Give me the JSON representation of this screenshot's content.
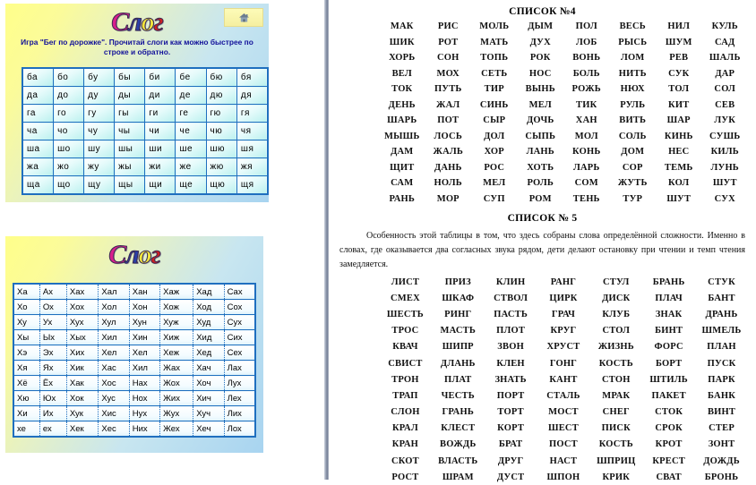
{
  "panel_syllables": {
    "logo": {
      "c": "С",
      "l": "л",
      "o": "о",
      "g": "г"
    },
    "home_icon": "home-icon",
    "subtitle": "Игра \"Бег по дорожке\". Прочитай слоги как можно быстрее по строке и обратно.",
    "grid": [
      [
        "ба",
        "бо",
        "бу",
        "бы",
        "би",
        "бе",
        "бю",
        "бя"
      ],
      [
        "да",
        "до",
        "ду",
        "ды",
        "ди",
        "де",
        "дю",
        "дя"
      ],
      [
        "га",
        "го",
        "гу",
        "гы",
        "ги",
        "ге",
        "гю",
        "гя"
      ],
      [
        "ча",
        "чо",
        "чу",
        "чы",
        "чи",
        "че",
        "чю",
        "чя"
      ],
      [
        "ша",
        "шо",
        "шу",
        "шы",
        "ши",
        "ше",
        "шю",
        "шя"
      ],
      [
        "жа",
        "жо",
        "жу",
        "жы",
        "жи",
        "же",
        "жю",
        "жя"
      ],
      [
        "ща",
        "що",
        "щу",
        "щы",
        "щи",
        "ще",
        "щю",
        "щя"
      ]
    ]
  },
  "panel_table_x": {
    "logo": {
      "c": "С",
      "l": "л",
      "o": "о",
      "g": "г"
    },
    "grid": [
      [
        "Ха",
        "Ах",
        "Хах",
        "Хал",
        "Хан",
        "Хаж",
        "Хад",
        "Сах"
      ],
      [
        "Хо",
        "Ох",
        "Хох",
        "Хол",
        "Хон",
        "Хож",
        "Ход",
        "Сох"
      ],
      [
        "Ху",
        "Ух",
        "Хух",
        "Хул",
        "Хун",
        "Хуж",
        "Худ",
        "Сух"
      ],
      [
        "Хы",
        "Ых",
        "Хых",
        "Хил",
        "Хин",
        "Хиж",
        "Хид",
        "Сих"
      ],
      [
        "Хэ",
        "Эх",
        "Хих",
        "Хел",
        "Хел",
        "Хеж",
        "Хед",
        "Сех"
      ],
      [
        "Хя",
        "Ях",
        "Хик",
        "Хас",
        "Хил",
        "Жах",
        "Хач",
        "Лах"
      ],
      [
        "Хё",
        "Ёх",
        "Хак",
        "Хос",
        "Нах",
        "Жох",
        "Хоч",
        "Лух"
      ],
      [
        "Хю",
        "Юх",
        "Хок",
        "Хус",
        "Нох",
        "Жих",
        "Хич",
        "Лех"
      ],
      [
        "Хи",
        "Их",
        "Хук",
        "Хис",
        "Нух",
        "Жух",
        "Хуч",
        "Лих"
      ],
      [
        "хе",
        "ех",
        "Хек",
        "Хес",
        "Них",
        "Жех",
        "Хеч",
        "Лох"
      ]
    ]
  },
  "list4": {
    "title": "СПИСОК №4",
    "rows": [
      [
        "МАК",
        "РИС",
        "МОЛЬ",
        "ДЫМ",
        "ПОЛ",
        "ВЕСЬ",
        "НИЛ",
        "КУЛЬ"
      ],
      [
        "ШИК",
        "РОТ",
        "МАТЬ",
        "ДУХ",
        "ЛОБ",
        "РЫСЬ",
        "ШУМ",
        "САД"
      ],
      [
        "ХОРЬ",
        "СОН",
        "ТОПЬ",
        "РОК",
        "ВОНЬ",
        "ЛОМ",
        "РЕВ",
        "ШАЛЬ"
      ],
      [
        "ВЕЛ",
        "МОХ",
        "СЕТЬ",
        "НОС",
        "БОЛЬ",
        "НИТЬ",
        "СУК",
        "ДАР"
      ],
      [
        "ТОК",
        "ПУТЬ",
        "ТИР",
        "ВЫНЬ",
        "РОЖЬ",
        "НЮХ",
        "ТОЛ",
        "СОЛ"
      ],
      [
        "ДЕНЬ",
        "ЖАЛ",
        "СИНЬ",
        "МЕЛ",
        "ТИК",
        "РУЛЬ",
        "КИТ",
        "СЕВ"
      ],
      [
        "ШАРЬ",
        "ПОТ",
        "СЫР",
        "ДОЧЬ",
        "ХАН",
        "ВИТЬ",
        "ШАР",
        "ЛУК"
      ],
      [
        "МЫШЬ",
        "ЛОСЬ",
        "ДОЛ",
        "СЫПЬ",
        "МОЛ",
        "СОЛЬ",
        "КИНЬ",
        "СУШЬ"
      ],
      [
        "ДАМ",
        "ЖАЛЬ",
        "ХОР",
        "ЛАНЬ",
        "КОНЬ",
        "ДОМ",
        "НЕС",
        "КИЛЬ"
      ],
      [
        "ЩИТ",
        "ДАНЬ",
        "РОС",
        "ХОТЬ",
        "ЛАРЬ",
        "СОР",
        "ТЕМЬ",
        "ЛУНЬ"
      ],
      [
        "САМ",
        "НОЛЬ",
        "МЕЛ",
        "РОЛЬ",
        "СОМ",
        "ЖУТЬ",
        "КОЛ",
        "ШУТ"
      ],
      [
        "РАНЬ",
        "МОР",
        "СУП",
        "РОМ",
        "ТЕНЬ",
        "ТУР",
        "ШУТ",
        "СУХ"
      ]
    ]
  },
  "list5": {
    "title": "СПИСОК № 5",
    "intro": "Особенность этой таблицы в том, что здесь собраны слова определённой сложности. Именно в словах, где оказывается два  согласных звука рядом, дети делают остановку при чтении и темп чтения замедляется.",
    "rows": [
      [
        "ЛИСТ",
        "ПРИЗ",
        "КЛИН",
        "РАНГ",
        "СТУЛ",
        "БРАНЬ",
        "СТУК"
      ],
      [
        "СМЕХ",
        "ШКАФ",
        "СТВОЛ",
        "ЦИРК",
        "ДИСК",
        "ПЛАЧ",
        "БАНТ"
      ],
      [
        "ШЕСТЬ",
        "РИНГ",
        "ПАСТЬ",
        "ГРАЧ",
        "КЛУБ",
        "ЗНАК",
        "ДРАНЬ"
      ],
      [
        "ТРОС",
        "МАСТЬ",
        "ПЛОТ",
        "КРУГ",
        "СТОЛ",
        "БИНТ",
        "ШМЕЛЬ"
      ],
      [
        "КВАЧ",
        "ШИПР",
        "ЗВОН",
        "ХРУСТ",
        "ЖИЗНЬ",
        "ФОРС",
        "ПЛАН"
      ],
      [
        "СВИСТ",
        "ДЛАНЬ",
        "КЛЕН",
        "ГОНГ",
        "КОСТЬ",
        "БОРТ",
        "ПУСК"
      ],
      [
        "ТРОН",
        "ПЛАТ",
        "ЗНАТЬ",
        "КАНТ",
        "СТОН",
        "ШТИЛЬ",
        "ПАРК"
      ],
      [
        "ТРАП",
        "ЧЕСТЬ",
        "ПОРТ",
        "СТАЛЬ",
        "МРАК",
        "ПАКЕТ",
        "БАНК"
      ],
      [
        "СЛОН",
        "ГРАНЬ",
        "ТОРТ",
        "МОСТ",
        "СНЕГ",
        "СТОК",
        "ВИНТ"
      ],
      [
        "КРАЛ",
        "КЛЕСТ",
        "КОРТ",
        "ШЕСТ",
        "ПИСК",
        "СРОК",
        "СТЕР"
      ],
      [
        "КРАН",
        "ВОЖДЬ",
        "БРАТ",
        "ПОСТ",
        "КОСТЬ",
        "КРОТ",
        "ЗОНТ"
      ],
      [
        "СКОТ",
        "ВЛАСТЬ",
        "ДРУГ",
        "НАСТ",
        "ШПРИЦ",
        "КРЕСТ",
        "ДОЖДЬ"
      ],
      [
        "РОСТ",
        "ШРАМ",
        "ДУСТ",
        "ШПОН",
        "КРИК",
        "СВАТ",
        "БРОНЬ"
      ]
    ]
  },
  "colors": {
    "panel_gradient_start": "#ffff8a",
    "panel_gradient_end": "#a8d4f0",
    "table_border": "#1f6fbf",
    "subtitle_text": "#12119a",
    "divider": "#8d97ab"
  }
}
